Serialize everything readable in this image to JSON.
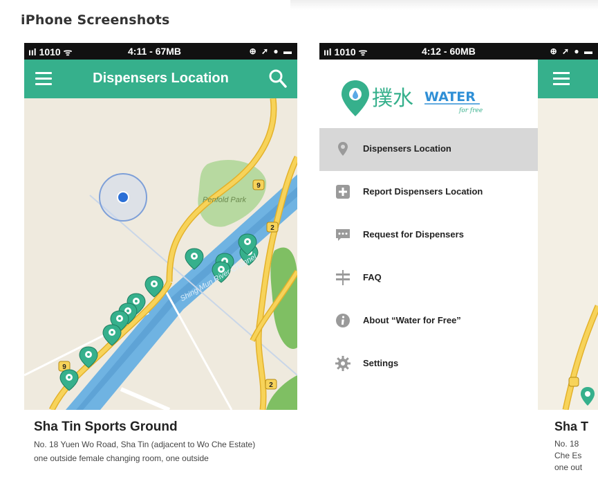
{
  "page": {
    "title": "iPhone Screenshots"
  },
  "phone1": {
    "status": {
      "carrier": "ııl 1010 ᯤ",
      "time": "4:11 - 67MB",
      "icons": "⊕ ➚ ● ▬"
    },
    "appbar": {
      "title": "Dispensers Location"
    },
    "map": {
      "park_label": "Penfold Park",
      "river_label": "Shing Mun River Channel",
      "road_markers": [
        "9",
        "9",
        "2",
        "2"
      ],
      "pin_count": 12
    },
    "card": {
      "name": "Sha Tin Sports Ground",
      "address": "No. 18 Yuen Wo Road, Sha Tin (adjacent to Wo Che Estate)",
      "description": "one outside female changing room, one outside"
    }
  },
  "phone2": {
    "status": {
      "carrier": "ııl 1010 ᯤ",
      "time": "4:12 - 60MB",
      "icons": "⊕ ➚ ● ▬"
    },
    "logo": {
      "chinese": "撲水",
      "english": "WATER",
      "tagline": "for free"
    },
    "menu": [
      {
        "label": "Dispensers Location",
        "icon": "location-pin-icon",
        "active": true
      },
      {
        "label": "Report Dispensers Location",
        "icon": "plus-box-icon",
        "active": false
      },
      {
        "label": "Request for Dispensers",
        "icon": "chat-bubble-icon",
        "active": false
      },
      {
        "label": "FAQ",
        "icon": "signpost-icon",
        "active": false
      },
      {
        "label": "About “Water for Free”",
        "icon": "info-icon",
        "active": false
      },
      {
        "label": "Settings",
        "icon": "gear-icon",
        "active": false
      }
    ],
    "peek_card": {
      "name": "Sha T",
      "line1": "No. 18",
      "line2": "Che Es",
      "line3": "one out"
    }
  },
  "colors": {
    "accent": "#36b08c",
    "status_bar": "#111111",
    "active_row": "#d7d7d7",
    "road": "#f4c542",
    "river": "#5fa6d8",
    "park": "#a9d18e"
  }
}
